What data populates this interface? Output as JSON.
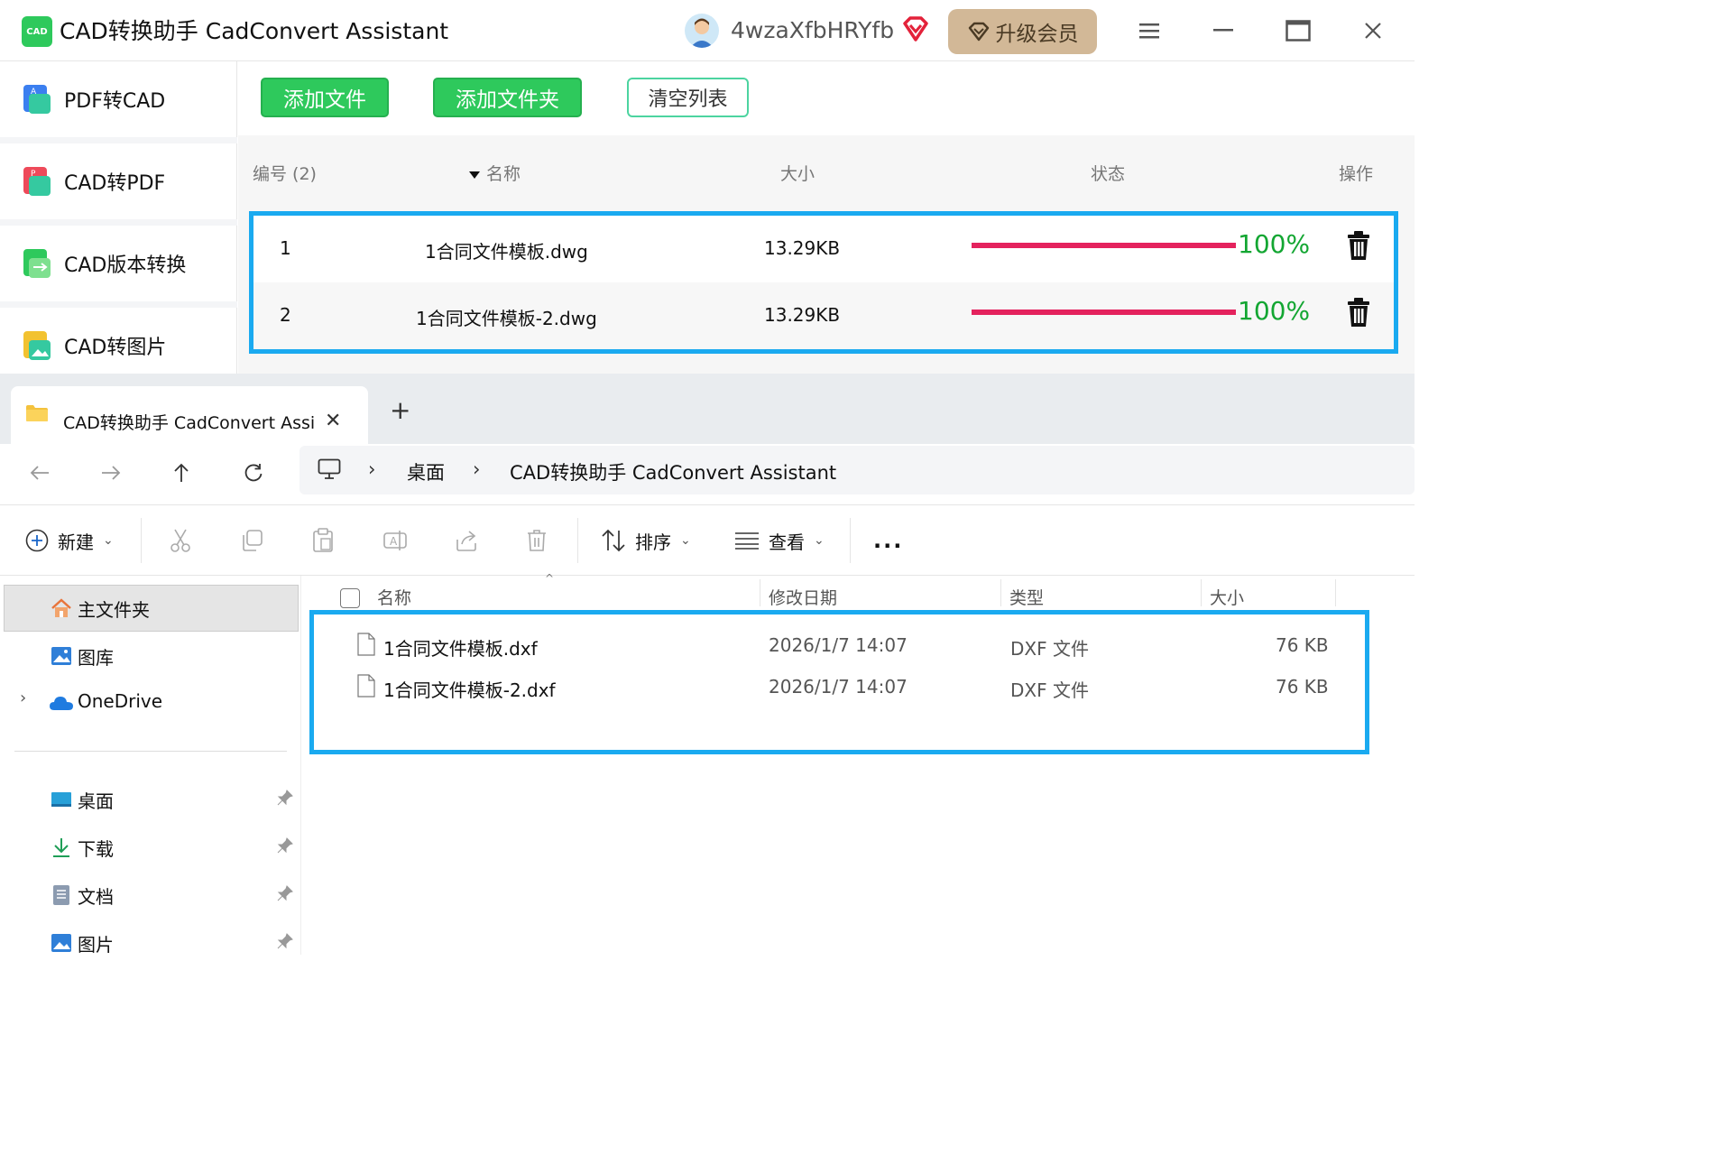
{
  "app": {
    "logo_text": "CAD",
    "title": "CAD转换助手 CadConvert Assistant",
    "username": "4wzaXfbHRYfb",
    "upgrade_label": "升级会员",
    "accent": "#2ec95c"
  },
  "sidebar": {
    "items": [
      {
        "label": "PDF转CAD",
        "icon": "pdf-to-cad-icon"
      },
      {
        "label": "CAD转PDF",
        "icon": "cad-to-pdf-icon"
      },
      {
        "label": "CAD版本转换",
        "icon": "cad-version-icon"
      },
      {
        "label": "CAD转图片",
        "icon": "cad-to-image-icon"
      }
    ]
  },
  "toolbar": {
    "add_file": "添加文件",
    "add_folder": "添加文件夹",
    "clear_list": "清空列表"
  },
  "table": {
    "headers": {
      "index": "编号 (2)",
      "name": "名称",
      "size": "大小",
      "status": "状态",
      "action": "操作"
    },
    "rows": [
      {
        "index": "1",
        "name": "1合同文件模板.dwg",
        "size": "13.29KB",
        "progress": 1.0,
        "percent": "100%"
      },
      {
        "index": "2",
        "name": "1合同文件模板-2.dwg",
        "size": "13.29KB",
        "progress": 1.0,
        "percent": "100%"
      }
    ],
    "progress_color": "#e4225d",
    "percent_color": "#13a632",
    "highlight_color": "#1aaaf0"
  },
  "explorer": {
    "tab_title": "CAD转换助手 CadConvert Assi",
    "breadcrumb": [
      "桌面",
      "CAD转换助手 CadConvert Assistant"
    ],
    "commands": {
      "new": "新建",
      "sort": "排序",
      "view": "查看",
      "more": "..."
    },
    "nav": {
      "home": "主文件夹",
      "gallery": "图库",
      "onedrive": "OneDrive",
      "desktop": "桌面",
      "downloads": "下载",
      "documents": "文档",
      "pictures": "图片"
    },
    "columns": {
      "name": "名称",
      "modified": "修改日期",
      "type": "类型",
      "size": "大小"
    },
    "files": [
      {
        "name": "1合同文件模板.dxf",
        "modified": "2026/1/7 14:07",
        "type": "DXF 文件",
        "size": "76 KB"
      },
      {
        "name": "1合同文件模板-2.dxf",
        "modified": "2026/1/7 14:07",
        "type": "DXF 文件",
        "size": "76 KB"
      }
    ]
  }
}
